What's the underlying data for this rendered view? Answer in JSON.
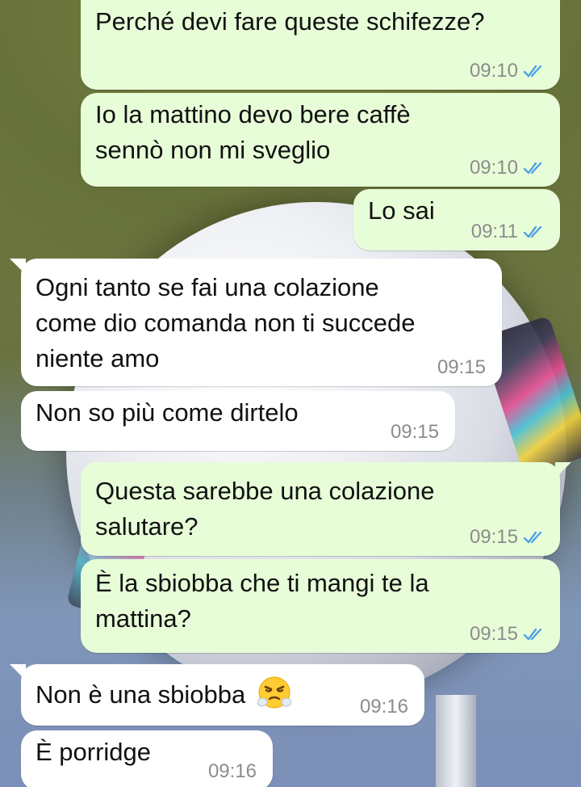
{
  "colors": {
    "outgoing_bubble": "#e7fdd8",
    "incoming_bubble": "#ffffff",
    "timestamp": "#8c8c8c",
    "read_ticks": "#4fa3e8"
  },
  "messages": [
    {
      "direction": "outgoing",
      "text": "Perché devi fare queste schifezze?",
      "time": "09:10",
      "status": "read-double-check-icon"
    },
    {
      "direction": "outgoing",
      "text": "Io la mattino devo bere caffè\nsennò non mi sveglio",
      "time": "09:10",
      "status": "read-double-check-icon"
    },
    {
      "direction": "outgoing",
      "text": "Lo sai",
      "time": "09:11",
      "status": "read-double-check-icon"
    },
    {
      "direction": "incoming",
      "text": "Ogni tanto se fai una colazione\ncome dio comanda non ti succede\nniente amo",
      "time": "09:15"
    },
    {
      "direction": "incoming",
      "text": "Non so più come dirtelo",
      "time": "09:15"
    },
    {
      "direction": "outgoing",
      "text": "Questa sarebbe una colazione\nsalutare?",
      "time": "09:15",
      "status": "read-double-check-icon"
    },
    {
      "direction": "outgoing",
      "text": "È la sbiobba che ti mangi te la\nmattina?",
      "time": "09:15",
      "status": "read-double-check-icon"
    },
    {
      "direction": "incoming",
      "text": "Non è una sbiobba",
      "emoji": "face-with-steam-from-nose-emoji",
      "time": "09:16"
    },
    {
      "direction": "incoming",
      "text": "È porridge",
      "time": "09:16"
    }
  ]
}
